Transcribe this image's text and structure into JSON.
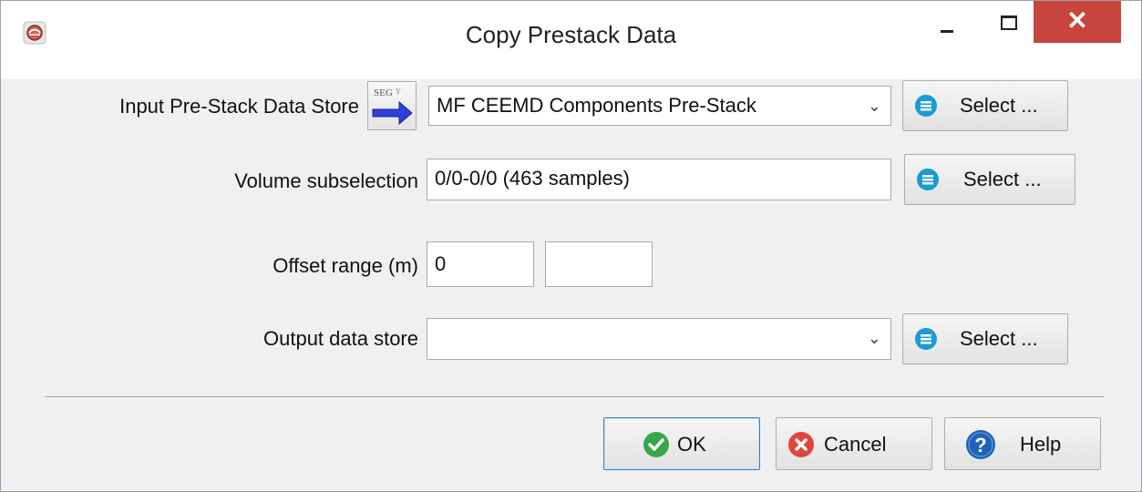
{
  "window": {
    "title": "Copy Prestack Data",
    "icon": "app-logo-icon",
    "controls": [
      "minimize-icon",
      "maximize-icon",
      "close-icon"
    ],
    "close_glyph": "✕"
  },
  "form": {
    "input_store": {
      "label": "Input Pre-Stack Data Store",
      "import_icon": "segy-import-icon",
      "value": "MF CEEMD Components Pre-Stack",
      "select_label": "Select ..."
    },
    "volume_subsel": {
      "label": "Volume subselection",
      "value": "0/0-0/0 (463 samples)",
      "select_label": "Select ..."
    },
    "offset_range": {
      "label": "Offset range (m)",
      "start": "0",
      "stop": ""
    },
    "output_store": {
      "label": "Output data store",
      "value": "",
      "select_label": "Select ..."
    }
  },
  "buttons": {
    "ok": "OK",
    "cancel": "Cancel",
    "help": "Help"
  },
  "colors": {
    "close_button": "#c7453c",
    "select_icon": "#1a9ad6",
    "ok_icon": "#3aa64a",
    "cancel_icon": "#e0453a",
    "help_icon": "#1e63b8"
  }
}
